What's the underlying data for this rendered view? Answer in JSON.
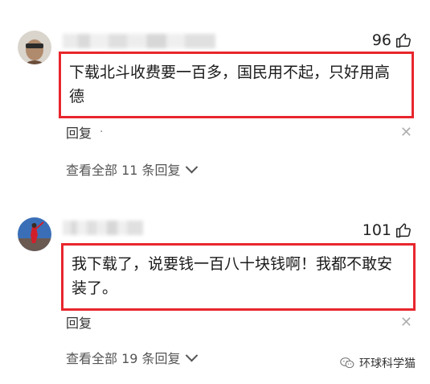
{
  "comments": [
    {
      "likes": "96",
      "text": "下载北斗收费要一百多，国民用不起，只好用高德",
      "reply_label": "回复",
      "reply_dot": "·",
      "view_all": "查看全部 11 条回复"
    },
    {
      "likes": "101",
      "text": "我下载了，说要钱一百八十块钱啊！我都不敢安装了。",
      "reply_label": "回复",
      "reply_dot": "·",
      "view_all": "查看全部 19 条回复"
    }
  ],
  "watermark": {
    "text": "环球科学猫"
  },
  "colors": {
    "highlight_border": "#e8262d"
  },
  "icons": [
    "avatar",
    "thumbs-up-icon",
    "close-icon",
    "chevron-down-icon",
    "wechat-icon"
  ]
}
